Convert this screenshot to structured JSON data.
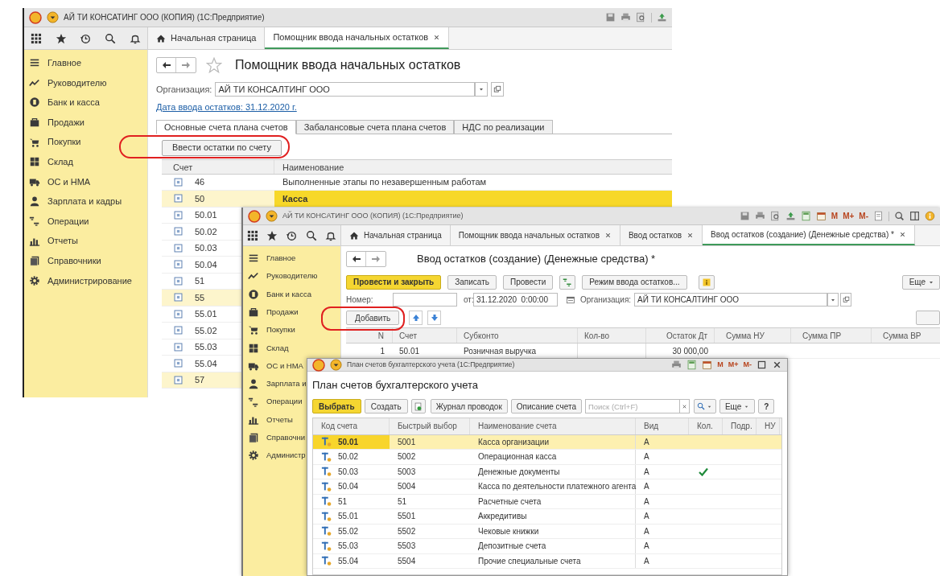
{
  "main_window": {
    "title": "АЙ ТИ КОНСАТИНГ ООО (КОПИЯ)  (1С:Предприятие)",
    "sections": [
      "Главное",
      "Руководителю",
      "Банк и касса",
      "Продажи",
      "Покупки",
      "Склад",
      "ОС и НМА",
      "Зарплата и кадры",
      "Операции",
      "Отчеты",
      "Справочники",
      "Администрирование"
    ],
    "tabs": [
      {
        "label": "Начальная страница",
        "selected": false,
        "kind": "home"
      },
      {
        "label": "Помощник ввода начальных остатков",
        "selected": true,
        "kind": "closable"
      }
    ],
    "page_title": "Помощник ввода начальных остатков",
    "organization": {
      "label": "Организация:",
      "value": "АЙ ТИ КОНСАЛТИНГ ООО"
    },
    "date_link": "Дата ввода остатков: 31.12.2020 г.",
    "subtabs": [
      {
        "label": "Основные счета плана счетов",
        "selected": true
      },
      {
        "label": "Забалансовые счета плана счетов",
        "selected": false
      },
      {
        "label": "НДС по реализации",
        "selected": false
      }
    ],
    "action_button": "Ввести остатки по счету",
    "table": {
      "columns": [
        "Счет",
        "Наименование"
      ],
      "rows": [
        {
          "account": "46",
          "name": "Выполненные этапы по незавершенным работам",
          "selected": false,
          "group": false
        },
        {
          "account": "50",
          "name": "Касса",
          "selected": true,
          "group": true
        },
        {
          "account": "50.01",
          "group": false
        },
        {
          "account": "50.02",
          "group": false
        },
        {
          "account": "50.03",
          "group": false
        },
        {
          "account": "50.04",
          "group": false
        },
        {
          "account": "51",
          "group": false
        },
        {
          "account": "55",
          "group": true
        },
        {
          "account": "55.01",
          "group": false
        },
        {
          "account": "55.02",
          "group": false
        },
        {
          "account": "55.03",
          "group": false
        },
        {
          "account": "55.04",
          "group": false
        },
        {
          "account": "57",
          "group": true
        }
      ]
    }
  },
  "document_window": {
    "title": "АЙ ТИ КОНСАТИНГ ООО (КОПИЯ)  (1С:Предприятие)",
    "memory_buttons": [
      "M",
      "M+",
      "M-"
    ],
    "sections": [
      "Главное",
      "Руководителю",
      "Банк и касса",
      "Продажи",
      "Покупки",
      "Склад",
      "ОС и НМА",
      "Зарплата и",
      "Операции",
      "Отчеты",
      "Справочни",
      "Администр"
    ],
    "tabs": [
      {
        "label": "Начальная страница",
        "selected": false,
        "kind": "home"
      },
      {
        "label": "Помощник ввода начальных остатков",
        "selected": false,
        "kind": "closable"
      },
      {
        "label": "Ввод остатков",
        "selected": false,
        "kind": "closable"
      },
      {
        "label": "Ввод остатков (создание) (Денежные средства) *",
        "selected": true,
        "kind": "closable"
      }
    ],
    "page_title": "Ввод остатков (создание) (Денежные средства) *",
    "toolbar": [
      {
        "label": "Провести и закрыть",
        "kind": "primary"
      },
      {
        "label": "Записать",
        "kind": "default"
      },
      {
        "label": "Провести",
        "kind": "default"
      },
      {
        "kind": "ledger"
      },
      {
        "label": "Режим ввода остатков...",
        "kind": "default"
      },
      {
        "kind": "info"
      }
    ],
    "more_button": "Еще",
    "number": {
      "label": "Номер:"
    },
    "date": {
      "label": "от:",
      "value": "31.12.2020  0:00:00"
    },
    "organization": {
      "label": "Организация:",
      "value": "АЙ ТИ КОНСАЛТИНГ ООО"
    },
    "add_button": "Добавить",
    "table": {
      "columns": [
        "N",
        "Счет",
        "Субконто",
        "Кол-во",
        "Остаток Дт",
        "Сумма НУ",
        "Сумма ПР",
        "Сумма ВР"
      ],
      "rows": [
        {
          "cells": [
            "1",
            "50.01",
            "Розничная выручка",
            "",
            "30 000,00",
            "",
            "",
            ""
          ]
        }
      ]
    }
  },
  "chart_window": {
    "title": "План счетов бухгалтерского учета  (1С:Предприятие)",
    "memory_buttons": [
      "M",
      "M+",
      "M-"
    ],
    "heading": "План счетов бухгалтерского учета",
    "select_button": "Выбрать",
    "create_button": "Создать",
    "journal_button": "Журнал проводок",
    "description_button": "Описание счета",
    "search": {
      "placeholder": "Поиск (Ctrl+F)"
    },
    "more_button": "Еще",
    "help_button": "?",
    "columns": [
      "Код счета",
      "Быстрый выбор",
      "Наименование счета",
      "Вид",
      "Кол.",
      "Подр.",
      "НУ"
    ],
    "rows": [
      {
        "code": "50.01",
        "quick": "5001",
        "name": "Касса организации",
        "type": "А",
        "quantity": false,
        "selected": true
      },
      {
        "code": "50.02",
        "quick": "5002",
        "name": "Операционная касса",
        "type": "А",
        "quantity": false,
        "selected": false
      },
      {
        "code": "50.03",
        "quick": "5003",
        "name": "Денежные документы",
        "type": "А",
        "quantity": true,
        "selected": false
      },
      {
        "code": "50.04",
        "quick": "5004",
        "name": "Касса по деятельности платежного агента",
        "type": "А",
        "quantity": false,
        "selected": false
      },
      {
        "code": "51",
        "quick": "51",
        "name": "Расчетные счета",
        "type": "А",
        "quantity": false,
        "selected": false
      },
      {
        "code": "55.01",
        "quick": "5501",
        "name": "Аккредитивы",
        "type": "А",
        "quantity": false,
        "selected": false
      },
      {
        "code": "55.02",
        "quick": "5502",
        "name": "Чековые книжки",
        "type": "А",
        "quantity": false,
        "selected": false
      },
      {
        "code": "55.03",
        "quick": "5503",
        "name": "Депозитные счета",
        "type": "А",
        "quantity": false,
        "selected": false
      },
      {
        "code": "55.04",
        "quick": "5504",
        "name": "Прочие специальные счета",
        "type": "А",
        "quantity": false,
        "selected": false
      }
    ]
  }
}
